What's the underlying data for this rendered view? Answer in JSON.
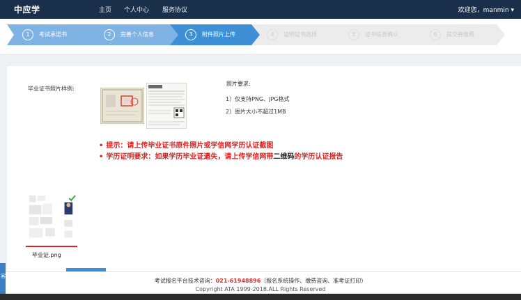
{
  "header": {
    "brand": "中应学",
    "nav": [
      "主页",
      "个人中心",
      "服务协议"
    ],
    "welcome": "欢迎您，manmin ▾"
  },
  "steps": [
    {
      "num": "1",
      "label": "考试承诺书",
      "state": "done"
    },
    {
      "num": "2",
      "label": "完善个人信息",
      "state": "done"
    },
    {
      "num": "3",
      "label": "附件照片上传",
      "state": "active"
    },
    {
      "num": "4",
      "label": "证明证书选择",
      "state": "inactive"
    },
    {
      "num": "5",
      "label": "证书信息确认",
      "state": "inactive"
    },
    {
      "num": "6",
      "label": "提交并缴费",
      "state": "inactive"
    }
  ],
  "colors": {
    "step_done": "#7fb3e3",
    "step_active": "#3d8fd6",
    "step_inactive": "#ececec",
    "tip_red": "#e02020",
    "nav_bg": "#1a2f4a"
  },
  "sample": {
    "label": "毕业证书照片样例:"
  },
  "requirements": {
    "title": "照片要求:",
    "items": [
      "1）仅支持PNG、JPG格式",
      "2）图片大小不超过1MB"
    ]
  },
  "tips": {
    "tip1": "提示：请上传毕业证书原件照片或学信网学历认证截图",
    "tip2_before": "学历证明要求：如果学历毕业证遗失，请上传学信网带",
    "tip2_black": "二维码",
    "tip2_after": "的学历认证报告"
  },
  "upload": {
    "filename": "毕业证.png"
  },
  "footer": {
    "line1_prefix": "考试报名平台技术咨询：",
    "phone": "021-61948896",
    "line1_suffix": "（报名系统操作、缴费咨询、准考证打印）",
    "line2": "Copyright ATA 1999-2018.ALL Rights Reserved"
  },
  "side_tab": "客"
}
